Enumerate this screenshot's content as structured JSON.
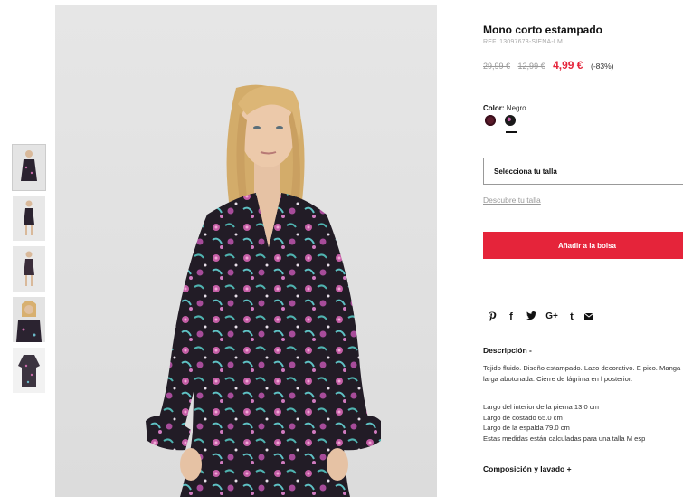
{
  "product": {
    "title": "Mono corto estampado",
    "ref": "REF. 13097673-SIENA-LM",
    "price_original": "29,99 €",
    "price_previous": "12,99 €",
    "price_current": "4,99 €",
    "discount": "(-83%)"
  },
  "color": {
    "label": "Color:",
    "selected": "Negro",
    "swatches": [
      {
        "name": "burgundy",
        "hex": "#5a1a2a"
      },
      {
        "name": "black-print",
        "hex": "#1a1a1a"
      }
    ]
  },
  "size": {
    "select_label": "Selecciona tu talla",
    "guide_link": "Descubre tu talla"
  },
  "cart": {
    "add_label": "Añadir a la bolsa"
  },
  "share": {
    "icons": [
      "pinterest-icon",
      "facebook-icon",
      "twitter-icon",
      "google-plus-icon",
      "tumblr-icon",
      "email-icon"
    ],
    "glyphs": [
      "℗",
      "f",
      "🐦",
      "G+",
      "t",
      "✉"
    ]
  },
  "description": {
    "title": "Descripción  -",
    "text": "Tejido fluido. Diseño estampado. Lazo decorativo. E pico. Manga larga abotonada. Cierre de lágrima en l posterior.",
    "measurements": [
      "Largo del interior de la pierna 13.0 cm",
      "Largo de costado 65.0 cm",
      "Largo de la espalda 79.0 cm",
      "Estas medidas están calculadas para una talla M esp"
    ]
  },
  "composition": {
    "title": "Composición y lavado  +"
  },
  "colors": {
    "accent": "#e5243a",
    "text": "#111111",
    "muted": "#999999"
  }
}
